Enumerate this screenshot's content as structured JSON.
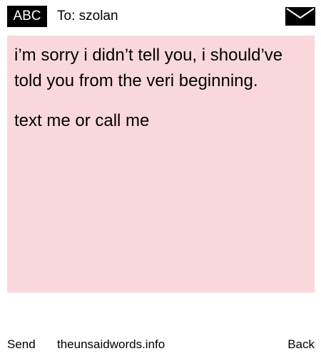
{
  "header": {
    "mode_label": "ABC",
    "recipient": "To: szolan",
    "icon": "envelope-icon"
  },
  "message": {
    "paragraphs": [
      "i’m sorry i didn’t tell you, i should’ve told you from the veri beginning.",
      "text me or call me"
    ],
    "background_color": "#f9d8dc"
  },
  "footer": {
    "send_label": "Send",
    "site_label": "theunsaidwords.info",
    "back_label": "Back"
  }
}
